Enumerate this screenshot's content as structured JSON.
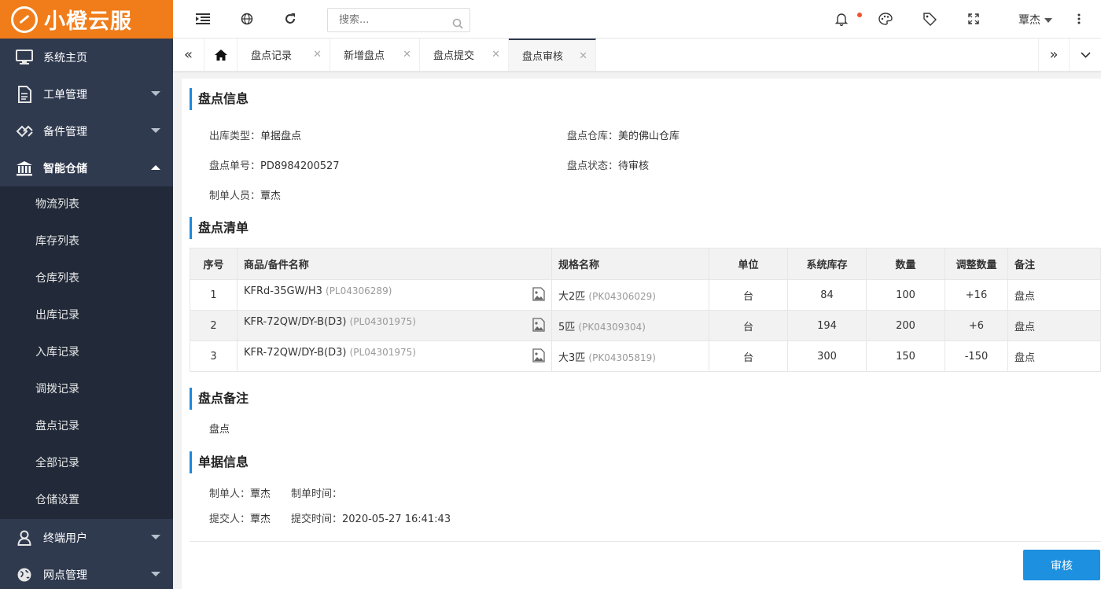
{
  "app": {
    "logo_text": "小橙云服",
    "brand_color": "#f07c1a",
    "accent_color": "#1e90e0"
  },
  "sidebar": {
    "items": [
      {
        "label": "系统主页",
        "icon": "monitor-icon"
      },
      {
        "label": "工单管理",
        "icon": "document-icon"
      },
      {
        "label": "备件管理",
        "icon": "parts-icon"
      },
      {
        "label": "智能仓储",
        "icon": "warehouse-icon"
      }
    ],
    "submenu": [
      "物流列表",
      "库存列表",
      "仓库列表",
      "出库记录",
      "入库记录",
      "调拨记录",
      "盘点记录",
      "全部记录",
      "仓储设置"
    ],
    "bottom_items": [
      {
        "label": "终端用户",
        "icon": "user-icon"
      },
      {
        "label": "网点管理",
        "icon": "globe-icon"
      }
    ]
  },
  "topbar": {
    "search_placeholder": "搜索...",
    "user_name": "覃杰"
  },
  "tabs": [
    "盘点记录",
    "新增盘点",
    "盘点提交",
    "盘点审核"
  ],
  "sections": {
    "info_title": "盘点信息",
    "list_title": "盘点清单",
    "remark_title": "盘点备注",
    "doc_title": "单据信息"
  },
  "info": {
    "out_type_label": "出库类型：",
    "out_type": "单据盘点",
    "warehouse_label": "盘点仓库：",
    "warehouse": "美的佛山仓库",
    "order_no_label": "盘点单号：",
    "order_no": "PD8984200527",
    "status_label": "盘点状态：",
    "status": "待审核",
    "creator_label": "制单人员：",
    "creator": "覃杰"
  },
  "table": {
    "headers": [
      "序号",
      "商品/备件名称",
      "规格名称",
      "单位",
      "系统库存",
      "数量",
      "调整数量",
      "备注"
    ],
    "rows": [
      {
        "no": "1",
        "name": "KFRd-35GW/H3",
        "name_code": "(PL04306289)",
        "spec": "大2匹",
        "spec_code": "(PK04306029)",
        "unit": "台",
        "stock": "84",
        "qty": "100",
        "adjust": "+16",
        "note": "盘点"
      },
      {
        "no": "2",
        "name": "KFR-72QW/DY-B(D3)",
        "name_code": "(PL04301975)",
        "spec": "5匹",
        "spec_code": "(PK04309304)",
        "unit": "台",
        "stock": "194",
        "qty": "200",
        "adjust": "+6",
        "note": "盘点"
      },
      {
        "no": "3",
        "name": "KFR-72QW/DY-B(D3)",
        "name_code": "(PL04301975)",
        "spec": "大3匹",
        "spec_code": "(PK04305819)",
        "unit": "台",
        "stock": "300",
        "qty": "150",
        "adjust": "-150",
        "note": "盘点"
      }
    ]
  },
  "remark": "盘点",
  "doc": {
    "maker_label": "制单人：",
    "maker": "覃杰",
    "make_time_label": "制单时间：",
    "make_time": "",
    "submitter_label": "提交人：",
    "submitter": "覃杰",
    "submit_time_label": "提交时间：",
    "submit_time": "2020-05-27 16:41:43"
  },
  "actions": {
    "audit_label": "审核"
  }
}
